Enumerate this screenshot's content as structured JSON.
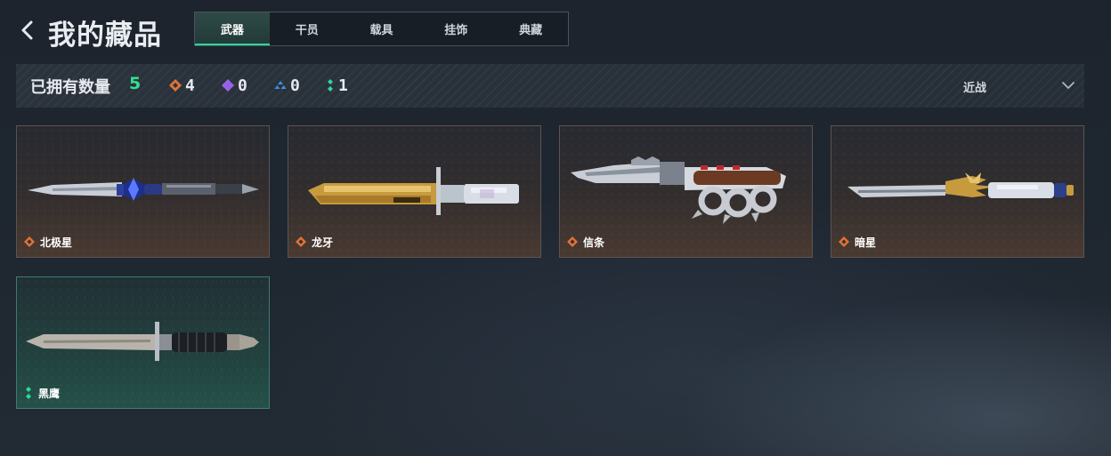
{
  "header": {
    "title": "我的藏品",
    "tabs": [
      {
        "label": "武器",
        "active": true
      },
      {
        "label": "干员",
        "active": false
      },
      {
        "label": "载具",
        "active": false
      },
      {
        "label": "挂饰",
        "active": false
      },
      {
        "label": "典藏",
        "active": false
      }
    ]
  },
  "summary": {
    "owned_label": "已拥有数量",
    "owned_count": "5",
    "rarity_counts": [
      {
        "icon": "orange-diamond-icon",
        "color": "#e0733a",
        "count": "4"
      },
      {
        "icon": "purple-diamond-icon",
        "color": "#9a63e8",
        "count": "0"
      },
      {
        "icon": "blue-triangle-icon",
        "color": "#3f8fe0",
        "count": "0"
      },
      {
        "icon": "green-dots-icon",
        "color": "#2ed89c",
        "count": "1"
      }
    ],
    "sort": {
      "selected": "近战"
    }
  },
  "items": [
    {
      "name": "北极星",
      "rarity": "orange",
      "rarity_color": "#e0733a",
      "weapon": "polaris-knife"
    },
    {
      "name": "龙牙",
      "rarity": "orange",
      "rarity_color": "#e0733a",
      "weapon": "dragon-fang-knife"
    },
    {
      "name": "信条",
      "rarity": "orange",
      "rarity_color": "#e0733a",
      "weapon": "creed-knuckle-knife"
    },
    {
      "name": "暗星",
      "rarity": "orange",
      "rarity_color": "#e0733a",
      "weapon": "dark-star-knife"
    },
    {
      "name": "黑鹰",
      "rarity": "green",
      "rarity_color": "#2ed89c",
      "weapon": "black-hawk-dagger"
    }
  ],
  "colors": {
    "accent_green": "#2ed89c",
    "count_green": "#31e08f",
    "orange_card_border": "#5c5450",
    "green_card_border": "#3f7a73"
  }
}
